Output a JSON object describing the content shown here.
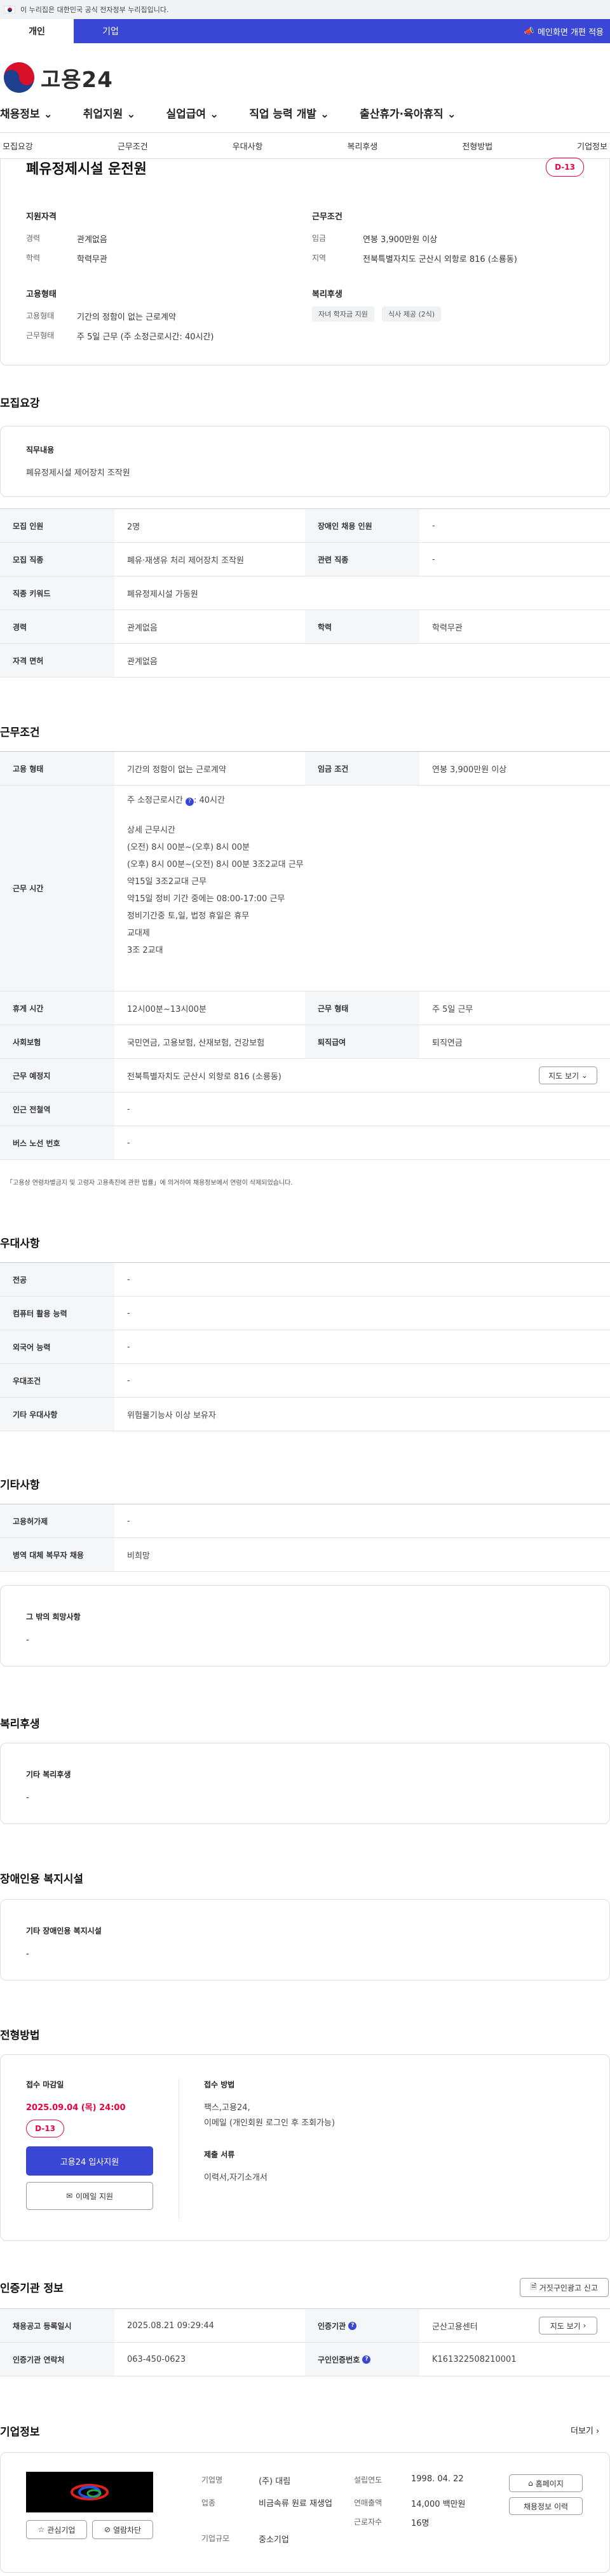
{
  "topbar": {
    "notice": "이 누리집은 대한민국 공식 전자정부 누리집입니다."
  },
  "tabs": [
    {
      "label": "개인"
    },
    {
      "label": "기업"
    }
  ],
  "bluebar": {
    "right": "메인화면 개편 적용"
  },
  "logo": {
    "text": "고용24"
  },
  "gnb": [
    "채용정보",
    "취업지원",
    "실업급여",
    "직업 능력 개발",
    "출산휴가·육아휴직"
  ],
  "subnav": [
    "모집요강",
    "근무조건",
    "우대사항",
    "복리후생",
    "전형방법",
    "기업정보"
  ],
  "summary": {
    "title": "폐유정제시설 운전원",
    "dday": "D-13",
    "qual": {
      "heading": "지원자격",
      "rows": [
        {
          "k": "경력",
          "v": "관계없음"
        },
        {
          "k": "학력",
          "v": "학력무관"
        }
      ]
    },
    "cond": {
      "heading": "근무조건",
      "rows": [
        {
          "k": "임금",
          "v": "연봉 3,900만원 이상"
        },
        {
          "k": "지역",
          "v": "전북특별자치도 군산시 외항로 816 (소룡동)"
        }
      ]
    },
    "emp": {
      "heading": "고용형태",
      "rows": [
        {
          "k": "고용형태",
          "v": "기간의 정함이 없는 근로계약"
        },
        {
          "k": "근무형태",
          "v": "주 5일 근무 (주 소정근로시간: 40시간)"
        }
      ]
    },
    "welfare": {
      "heading": "복리후생",
      "chips": [
        "자녀 학자금 지원",
        "식사 제공 (2식)"
      ]
    }
  },
  "recruit": {
    "title": "모집요강",
    "job_label": "직무내용",
    "job_value": "폐유정제시설 제어장치 조작원",
    "rows": [
      {
        "k1": "모집 인원",
        "v1": "2명",
        "k2": "장애인 채용 인원",
        "v2": "-"
      },
      {
        "k1": "모집 직종",
        "v1": "폐유·재생유 처리 제어장치 조작원",
        "k2": "관련 직종",
        "v2": "-"
      },
      {
        "k1": "직종 키워드",
        "v1": "폐유정제시설 가동원"
      },
      {
        "k1": "경력",
        "v1": "관계없음",
        "k2": "학력",
        "v2": "학력무관"
      },
      {
        "k1": "자격 면허",
        "v1": "관계없음"
      }
    ]
  },
  "work": {
    "title": "근무조건",
    "r1": {
      "k1": "고용 형태",
      "v1": "기간의 정함이 없는 근로계약",
      "k2": "임금 조건",
      "v2": "연봉 3,900만원 이상"
    },
    "hours_label": "근무 시간",
    "hours_main": "주 소정근로시간",
    "hours_main_val": ": 40시간",
    "hours_lines": [
      "상세 근무시간",
      "(오전) 8시 00분~(오후) 8시 00분",
      "(오후) 8시 00분~(오전) 8시 00분  3조2교대 근무",
      "약15일  3조2교대 근무",
      "약15일 정비 기간 중에는 08:00-17:00 근무",
      "정비기간중  토,일, 법정 휴일은 휴무",
      "교대제",
      "3조 2교대"
    ],
    "r3": {
      "k1": "휴게 시간",
      "v1": "12시00분~13시00분",
      "k2": "근무 형태",
      "v2": "주 5일 근무"
    },
    "r4": {
      "k1": "사회보험",
      "v1": "국민연금, 고용보험, 산재보험, 건강보험",
      "k2": "퇴직급여",
      "v2": "퇴직연금"
    },
    "r5": {
      "k1": "근무 예정지",
      "v1": "전북특별자치도 군산시 외항로 816 (소룡동)",
      "btn": "지도 보기"
    },
    "r6": {
      "k1": "인근 전철역",
      "v1": "-"
    },
    "r7": {
      "k1": "버스 노선 번호",
      "v1": "-"
    },
    "note": "「고용상 연령차별금지 및 고령자 고용촉진에 관한 법률」에 의거하여 채용정보에서 연령이 삭제되었습니다."
  },
  "prefer": {
    "title": "우대사항",
    "rows": [
      {
        "k": "전공",
        "v": "-"
      },
      {
        "k": "컴퓨터 활용 능력",
        "v": "-"
      },
      {
        "k": "외국어 능력",
        "v": "-"
      },
      {
        "k": "우대조건",
        "v": "-"
      },
      {
        "k": "기타 우대사항",
        "v": "위험물기능사 이상 보유자"
      }
    ]
  },
  "etc": {
    "title": "기타사항",
    "rows": [
      {
        "k": "고용허가제",
        "v": "-"
      },
      {
        "k": "병역 대체 복무자 채용",
        "v": "비희망"
      }
    ],
    "box_label": "그 밖의 희망사항",
    "box_value": "-"
  },
  "welfare": {
    "title": "복리후생",
    "box_label": "기타 복리후생",
    "box_value": "-"
  },
  "disability": {
    "title": "장애인용 복지시설",
    "box_label": "기타 장애인용 복지시설",
    "box_value": "-"
  },
  "process": {
    "title": "전형방법",
    "deadline_label": "접수 마감일",
    "deadline": "2025.09.04 (목) 24:00",
    "dday": "D-13",
    "apply_btn": "고용24 입사지원",
    "email_btn": "이메일 지원",
    "method_label": "접수 방법",
    "method_lines": [
      "팩스,고용24,",
      "이메일 (개인회원 로그인 후 조회가능)"
    ],
    "docs_label": "제출 서류",
    "docs_value": "이력서,자기소개서"
  },
  "agency": {
    "title": "인증기관 정보",
    "report_btn": "거짓구인광고 신고",
    "r1": {
      "k1": "채용공고 등록일시",
      "v1": "2025.08.21 09:29:44",
      "k2": "인증기관",
      "v2": "군산고용센터",
      "btn": "지도 보기"
    },
    "r2": {
      "k1": "인증기관 연락처",
      "v1": "063-450-0623",
      "k2": "구인인증번호",
      "v2": "K161322508210001"
    }
  },
  "company": {
    "title": "기업정보",
    "more": "더보기",
    "fav_btn": "관심기업",
    "block_btn": "열람차단",
    "rows": [
      {
        "k": "기업명",
        "v": "(주) 대림"
      },
      {
        "k": "업종",
        "v": "비금속류 원료 재생업"
      },
      {
        "k": "기업규모",
        "v": "중소기업"
      }
    ],
    "rows2": [
      {
        "k": "설립연도",
        "v": "1998. 04. 22"
      },
      {
        "k": "연매출액",
        "v": "14,000 백만원"
      },
      {
        "k": "근로자수",
        "v": "16명"
      }
    ],
    "home_btn": "홈페이지",
    "jobs_btn": "채용정보 이력"
  },
  "colors": {
    "primary": "#3a47d5",
    "dday": "#e6003c"
  }
}
